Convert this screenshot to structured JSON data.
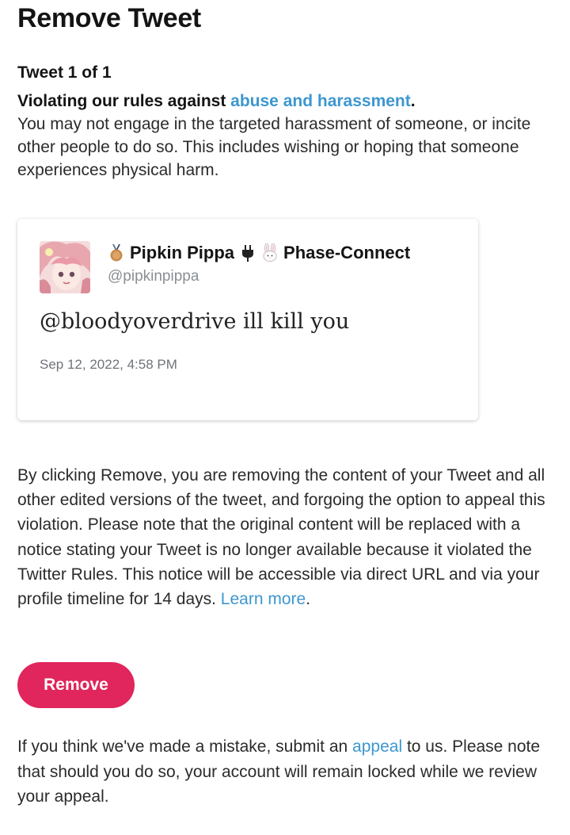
{
  "header": {
    "title": "Remove Tweet",
    "tweet_count": "Tweet 1 of 1"
  },
  "rules": {
    "lead": "Violating our rules against ",
    "link": "abuse and harassment",
    "lead_end": ".",
    "description": "You may not engage in the targeted harassment of someone, or incite other people to do so. This includes wishing or hoping that someone experiences physical harm."
  },
  "tweet": {
    "author_name": "Pipkin Pippa",
    "affiliation": "Phase-Connect",
    "handle": "@pipkinpippa",
    "text": "@bloodyoverdrive ill kill you",
    "timestamp": "Sep 12, 2022, 4:58 PM",
    "icons": [
      "medal-icon",
      "plug-icon",
      "rabbit-icon"
    ]
  },
  "notice": {
    "text": "By clicking Remove, you are removing the content of your Tweet and all other edited versions of the tweet, and forgoing the option to appeal this violation. Please note that the original content will be replaced with a notice stating your Tweet is no longer available because it violated the Twitter Rules. This notice will be accessible via direct URL and via your profile timeline for 14 days. ",
    "learn_more": "Learn more",
    "end": "."
  },
  "actions": {
    "remove_label": "Remove"
  },
  "appeal": {
    "before": "If you think we've made a mistake, submit an ",
    "link": "appeal",
    "after": " to us. Please note that should you do so, your account will remain locked while we review your appeal."
  },
  "colors": {
    "link": "#3d97cf",
    "remove_button": "#e0265c"
  }
}
